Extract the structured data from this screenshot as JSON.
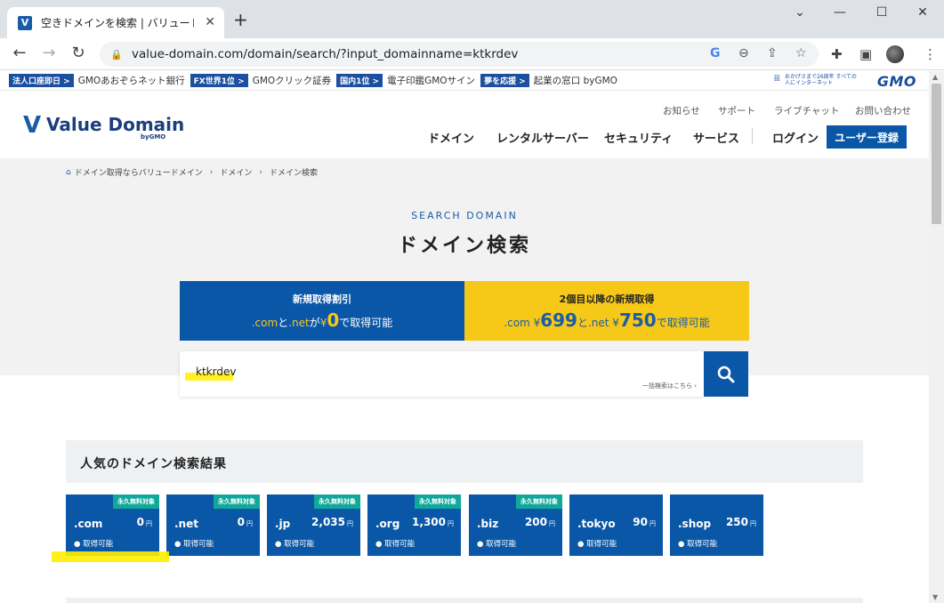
{
  "browser": {
    "tab_title": "空きドメインを検索 | バリュードメイン",
    "tab_close": "✕",
    "new_tab": "+",
    "url": "value-domain.com/domain/search/?input_domainname=ktkrdev",
    "window_controls": [
      "⌄",
      "—",
      "☐",
      "✕"
    ]
  },
  "gmo_bar": {
    "items": [
      {
        "tag": "法人口座即日 >",
        "text": "GMOあおぞらネット銀行"
      },
      {
        "tag": "FX世界1位 >",
        "text": "GMOクリック証券"
      },
      {
        "tag": "国内1位 >",
        "text": "電子印鑑GMOサイン"
      },
      {
        "tag": "夢を応援 >",
        "text": "起業の窓口 byGMO"
      }
    ],
    "tagline": "おかげさまで26周年 すべての人にインターネット",
    "logo": "GMO"
  },
  "header": {
    "logo_text": "Value Domain",
    "logo_by": "byGMO",
    "utility_links": [
      "お知らせ",
      "サポート",
      "ライブチャット",
      "お問い合わせ"
    ],
    "nav": [
      "ドメイン",
      "レンタルサーバー",
      "セキュリティ",
      "サービス"
    ],
    "login": "ログイン",
    "register": "ユーザー登録"
  },
  "breadcrumb": [
    "ドメイン取得ならバリュードメイン",
    "ドメイン",
    "ドメイン検索"
  ],
  "hero": {
    "label": "SEARCH DOMAIN",
    "title": "ドメイン検索"
  },
  "promo": {
    "left": {
      "title": "新規取得割引",
      "ext1": ".com",
      "mid1": "と",
      "ext2": ".net",
      "mid2": "が",
      "yen": "¥",
      "price": "0",
      "tail": "で取得可能"
    },
    "right": {
      "title": "2個目以降の新規取得",
      "ext1": ".com",
      "yen1": " ¥",
      "price1": "699",
      "mid": "と",
      "ext2": ".net",
      "yen2": " ¥",
      "price2": "750",
      "tail": "で取得可能"
    }
  },
  "search": {
    "value": "ktkrdev",
    "bulk_link": "一括検索はこちら ›"
  },
  "results": {
    "title": "人気のドメイン検索結果",
    "cards": [
      {
        "ext": ".com",
        "price": "0",
        "yen": "円",
        "status": "● 取得可能",
        "badge": "永久無料対象"
      },
      {
        "ext": ".net",
        "price": "0",
        "yen": "円",
        "status": "● 取得可能",
        "badge": "永久無料対象"
      },
      {
        "ext": ".jp",
        "price": "2,035",
        "yen": "円",
        "status": "● 取得可能",
        "badge": "永久無料対象"
      },
      {
        "ext": ".org",
        "price": "1,300",
        "yen": "円",
        "status": "● 取得可能",
        "badge": "永久無料対象"
      },
      {
        "ext": ".biz",
        "price": "200",
        "yen": "円",
        "status": "● 取得可能",
        "badge": "永久無料対象"
      },
      {
        "ext": ".tokyo",
        "price": "90",
        "yen": "円",
        "status": "● 取得可能",
        "badge": ""
      },
      {
        "ext": ".shop",
        "price": "250",
        "yen": "円",
        "status": "● 取得可能",
        "badge": ""
      }
    ]
  },
  "colors": {
    "brand_blue": "#0a57a8",
    "promo_yellow": "#f6c817",
    "badge_teal": "#10a89a",
    "highlight": "#ffee00"
  }
}
